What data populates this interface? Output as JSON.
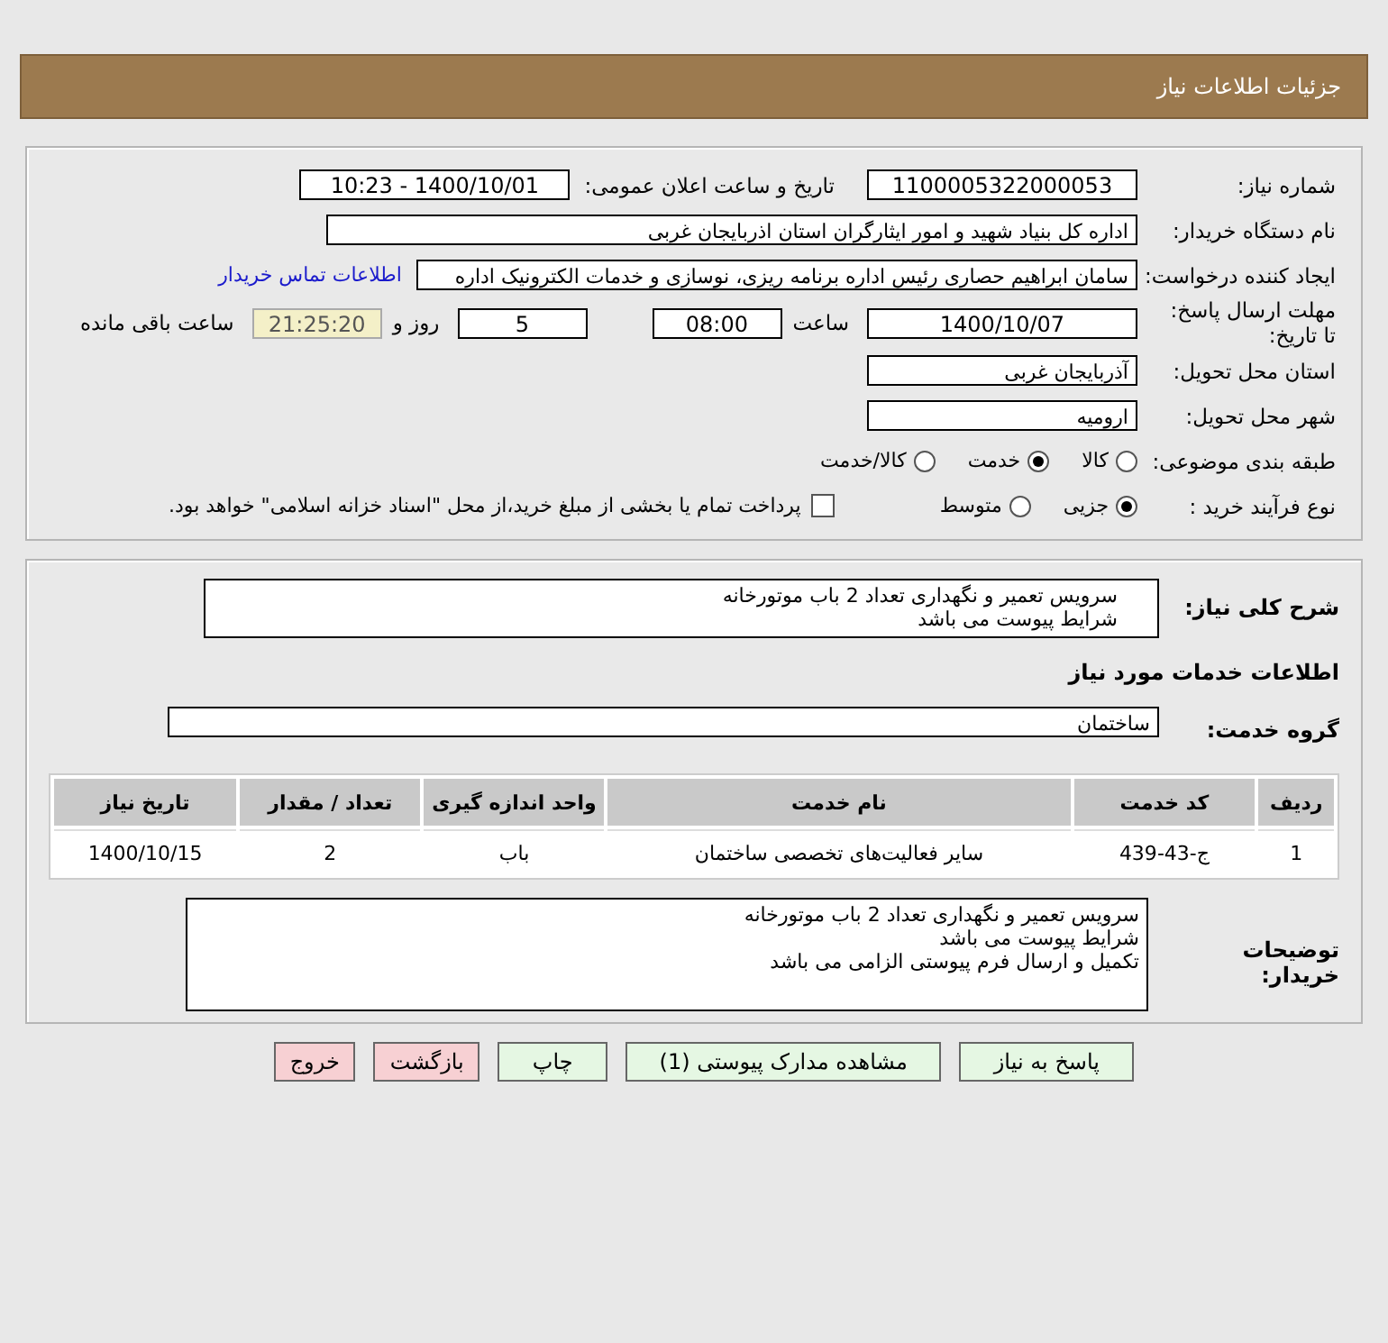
{
  "header": {
    "title": "جزئیات اطلاعات نیاز"
  },
  "details": {
    "need_number": {
      "label": "شماره نیاز:",
      "value": "1100005322000053"
    },
    "announce": {
      "label": "تاریخ و ساعت اعلان عمومی:",
      "value": "1400/10/01 - 10:23"
    },
    "buyer": {
      "label": "نام دستگاه خریدار:",
      "value": "اداره کل بنیاد شهید و امور ایثارگران استان اذربایجان غربی"
    },
    "requester": {
      "label": "ایجاد کننده درخواست:",
      "value": "سامان ابراهیم حصاری رئیس اداره برنامه ریزی، نوسازی و خدمات الکترونیک اداره",
      "link": "اطلاعات تماس خریدار"
    },
    "deadline": {
      "label": "مهلت ارسال پاسخ: تا تاریخ:",
      "date": "1400/10/07",
      "time_label": "ساعت",
      "time": "08:00",
      "days": "5",
      "days_label": "روز و",
      "remaining": "21:25:20",
      "remaining_label": "ساعت باقی مانده"
    },
    "province": {
      "label": "استان محل تحویل:",
      "value": "آذربایجان غربی"
    },
    "city": {
      "label": "شهر محل تحویل:",
      "value": "ارومیه"
    },
    "category": {
      "label": "طبقه بندی موضوعی:",
      "options": [
        {
          "label": "کالا",
          "selected": false
        },
        {
          "label": "خدمت",
          "selected": true
        },
        {
          "label": "کالا/خدمت",
          "selected": false
        }
      ]
    },
    "process": {
      "label": "نوع فرآیند خرید :",
      "options": [
        {
          "label": "جزیی",
          "selected": true
        },
        {
          "label": "متوسط",
          "selected": false
        }
      ],
      "payment": {
        "label": "پرداخت تمام یا بخشی از مبلغ خرید،از محل \"اسناد خزانه اسلامی\" خواهد بود.",
        "checked": false
      }
    }
  },
  "services": {
    "summary": {
      "label": "شرح کلی نیاز:",
      "lines": [
        "سرویس تعمیر و نگهداری تعداد 2 باب موتورخانه",
        "شرایط پیوست می باشد"
      ]
    },
    "heading": "اطلاعات خدمات مورد نیاز",
    "group": {
      "label": "گروه خدمت:",
      "value": "ساختمان"
    },
    "table": {
      "columns": [
        "ردیف",
        "کد خدمت",
        "نام خدمت",
        "واحد اندازه گیری",
        "تعداد / مقدار",
        "تاریخ نیاز"
      ],
      "rows": [
        [
          "1",
          "ج-43-439",
          "سایر فعالیت‌های تخصصی ساختمان",
          "باب",
          "2",
          "1400/10/15"
        ]
      ]
    },
    "notes": {
      "label": "توضیحات خریدار:",
      "lines": [
        "سرویس تعمیر و نگهداری تعداد 2 باب موتورخانه",
        "شرایط پیوست می باشد",
        "تکمیل و ارسال فرم پیوستی الزامی می باشد"
      ]
    }
  },
  "buttons": [
    {
      "label": "پاسخ به نیاز",
      "kind": "primary"
    },
    {
      "label": "مشاهده مدارک پیوستی (1)",
      "kind": "primary"
    },
    {
      "label": "چاپ",
      "kind": "primary"
    },
    {
      "label": "بازگشت",
      "kind": "danger"
    },
    {
      "label": "خروج",
      "kind": "danger"
    }
  ]
}
